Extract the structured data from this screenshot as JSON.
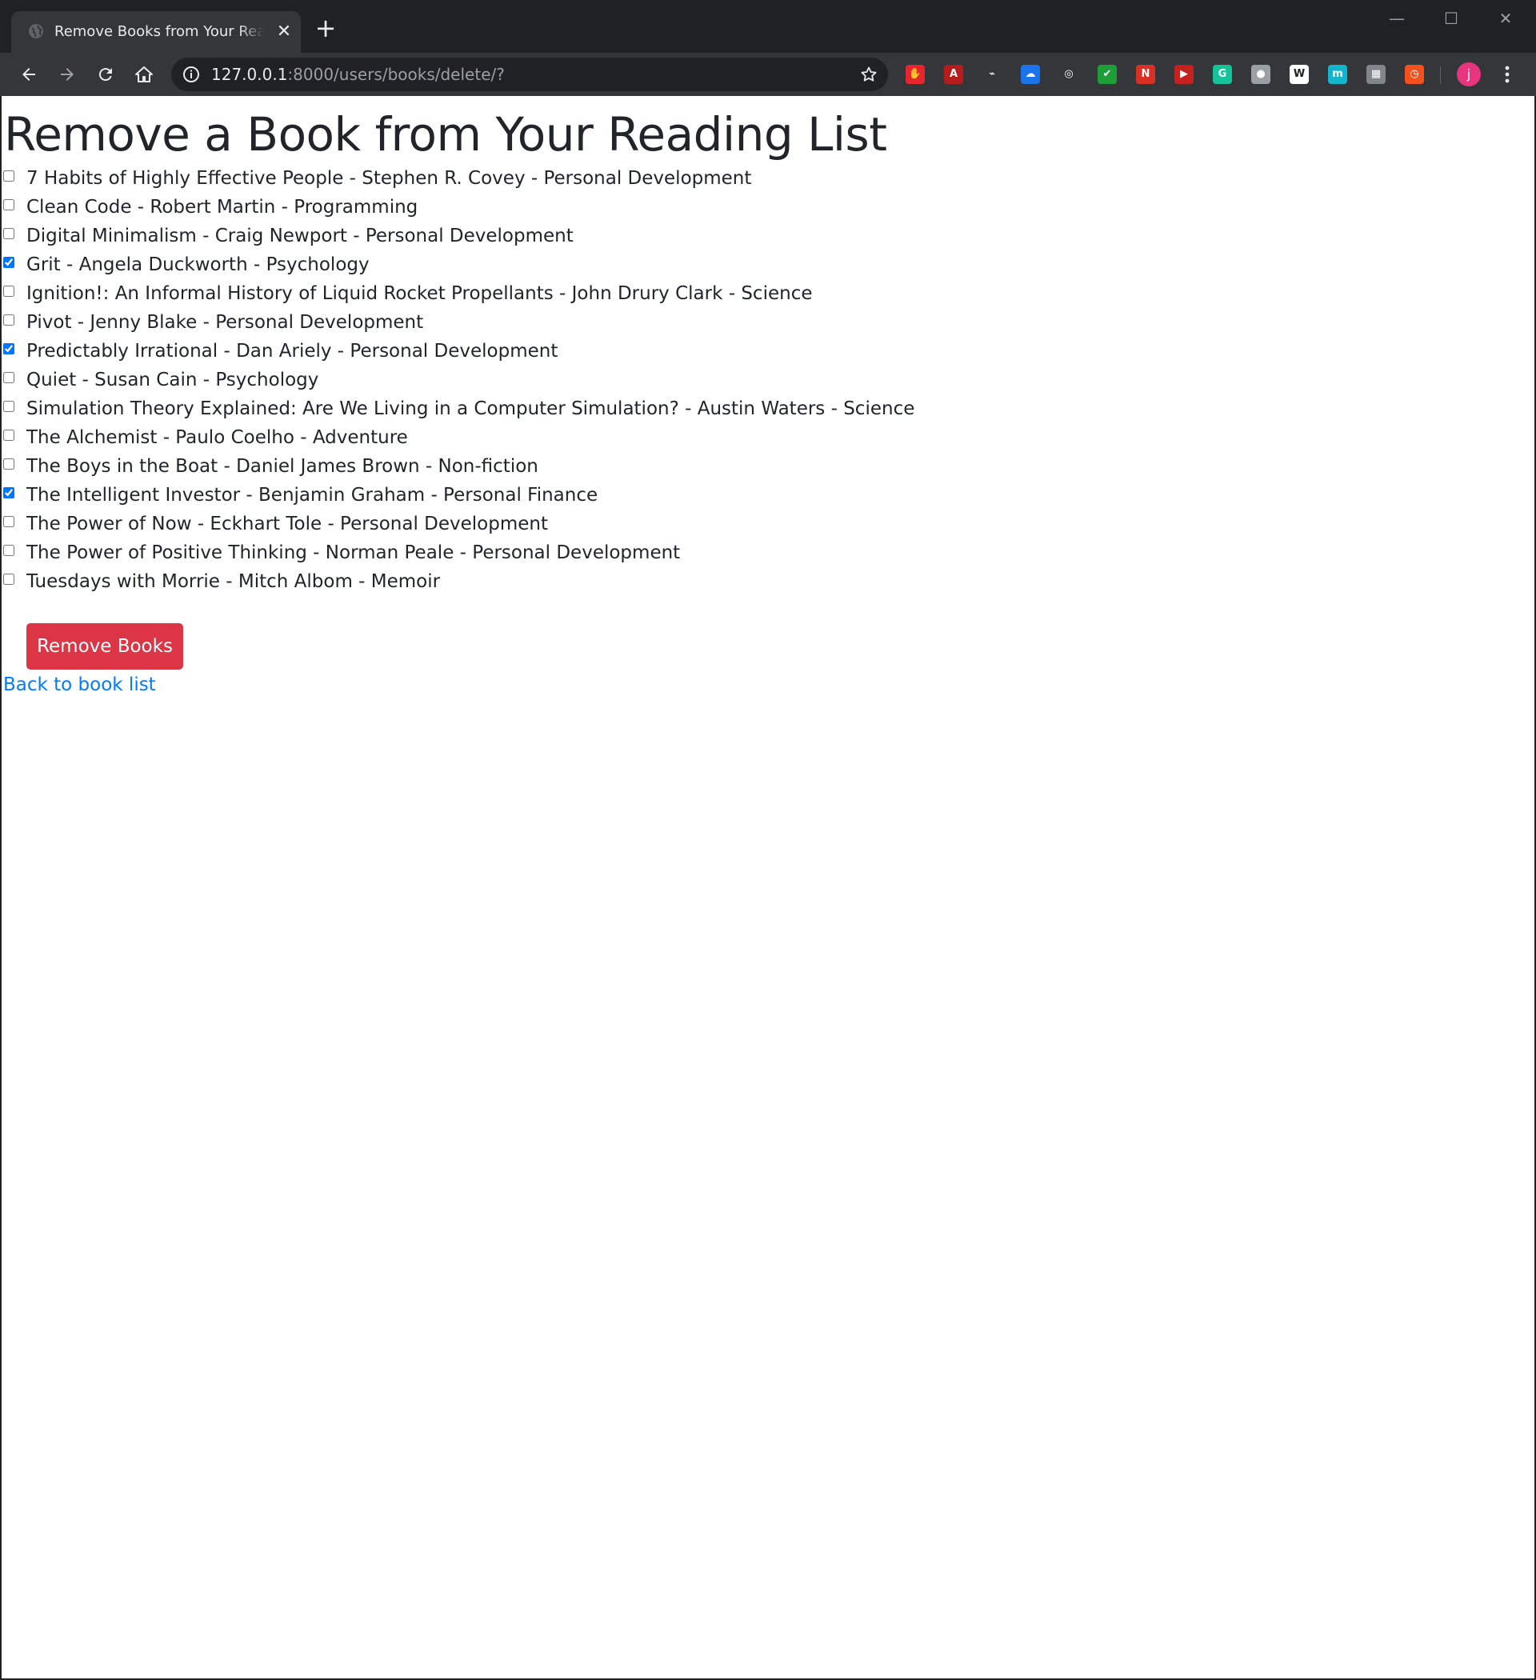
{
  "browser": {
    "tab": {
      "title": "Remove Books from Your Reading List",
      "close_glyph": "✕",
      "favicon": "globe-icon"
    },
    "new_tab_glyph": "+",
    "window_controls": {
      "minimize": "—",
      "maximize": "☐",
      "close": "✕"
    },
    "url": {
      "host": "127.0.0.1",
      "path": ":8000/users/books/delete/?"
    },
    "extensions": [
      {
        "name": "block-extension-icon",
        "color": "#e5262d",
        "glyph": "✋"
      },
      {
        "name": "pdf-extension-icon",
        "color": "#b71c1c",
        "glyph": "A"
      },
      {
        "name": "rainbow-extension-icon",
        "color": "#35363a",
        "glyph": "⌁"
      },
      {
        "name": "cloud-extension-icon",
        "color": "#1a73e8",
        "glyph": "☁"
      },
      {
        "name": "pocket-extension-icon",
        "color": "#35363a",
        "glyph": "◎"
      },
      {
        "name": "check-extension-icon",
        "color": "#1e9e38",
        "glyph": "✔"
      },
      {
        "name": "news-extension-icon",
        "color": "#d93025",
        "glyph": "N"
      },
      {
        "name": "play-extension-icon",
        "color": "#c5221f",
        "glyph": "▶"
      },
      {
        "name": "grammarly-extension-icon",
        "color": "#15c39a",
        "glyph": "G"
      },
      {
        "name": "camera-extension-icon",
        "color": "#9aa0a6",
        "glyph": "●"
      },
      {
        "name": "wikipedia-extension-icon",
        "color": "#ffffff",
        "glyph": "W"
      },
      {
        "name": "m-extension-icon",
        "color": "#12b5cb",
        "glyph": "m"
      },
      {
        "name": "chart-extension-icon",
        "color": "#80868b",
        "glyph": "▦"
      },
      {
        "name": "timer-extension-icon",
        "color": "#f4511e",
        "glyph": "◷"
      }
    ],
    "avatar_letter": "j"
  },
  "page": {
    "title": "Remove a Book from Your Reading List",
    "books": [
      {
        "label": "7 Habits of Highly Effective People - Stephen R. Covey - Personal Development",
        "checked": false
      },
      {
        "label": "Clean Code - Robert Martin - Programming",
        "checked": false
      },
      {
        "label": "Digital Minimalism - Craig Newport - Personal Development",
        "checked": false
      },
      {
        "label": "Grit - Angela Duckworth - Psychology",
        "checked": true
      },
      {
        "label": "Ignition!: An Informal History of Liquid Rocket Propellants - John Drury Clark - Science",
        "checked": false
      },
      {
        "label": "Pivot - Jenny Blake - Personal Development",
        "checked": false
      },
      {
        "label": "Predictably Irrational - Dan Ariely - Personal Development",
        "checked": true
      },
      {
        "label": "Quiet - Susan Cain - Psychology",
        "checked": false
      },
      {
        "label": "Simulation Theory Explained: Are We Living in a Computer Simulation? - Austin Waters - Science",
        "checked": false
      },
      {
        "label": "The Alchemist - Paulo Coelho - Adventure",
        "checked": false
      },
      {
        "label": "The Boys in the Boat - Daniel James Brown - Non-fiction",
        "checked": false
      },
      {
        "label": "The Intelligent Investor - Benjamin Graham - Personal Finance",
        "checked": true
      },
      {
        "label": "The Power of Now - Eckhart Tole - Personal Development",
        "checked": false
      },
      {
        "label": "The Power of Positive Thinking - Norman Peale - Personal Development",
        "checked": false
      },
      {
        "label": "Tuesdays with Morrie - Mitch Albom - Memoir",
        "checked": false
      }
    ],
    "submit_label": "Remove Books",
    "back_link_label": "Back to book list",
    "colors": {
      "danger": "#dc3545",
      "link": "#007bff",
      "text": "#212529"
    }
  }
}
